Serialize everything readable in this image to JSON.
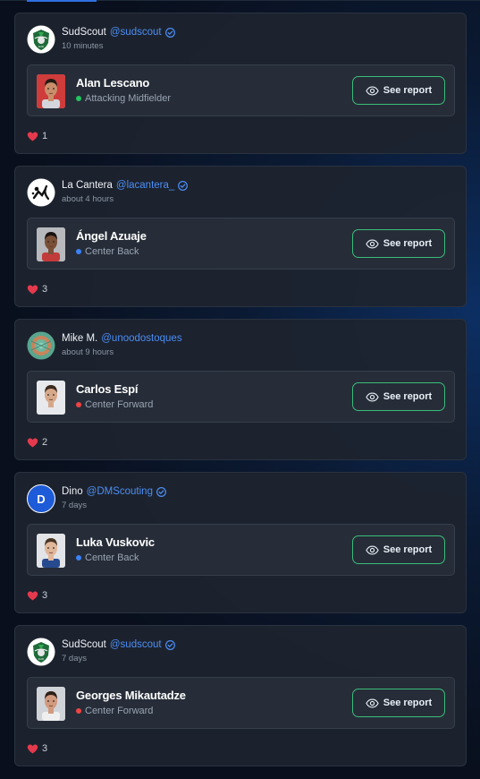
{
  "feed": {
    "posts": [
      {
        "author": {
          "name": "SudScout",
          "handle": "@sudscout",
          "verified": true,
          "avatar": "sudscout-logo"
        },
        "time": "10 minutes",
        "player": {
          "name": "Alan Lescano",
          "position": "Attacking Midfielder",
          "position_color": "#22c55e"
        },
        "button_label": "See report",
        "likes": "1"
      },
      {
        "author": {
          "name": "La Cantera",
          "handle": "@lacantera_",
          "verified": true,
          "avatar": "lacantera-logo"
        },
        "time": "about 4 hours",
        "player": {
          "name": "Ángel Azuaje",
          "position": "Center Back",
          "position_color": "#3b82f6"
        },
        "button_label": "See report",
        "likes": "3"
      },
      {
        "author": {
          "name": "Mike M.",
          "handle": "@unoodostoques",
          "verified": false,
          "avatar": "mike-avatar"
        },
        "time": "about 9 hours",
        "player": {
          "name": "Carlos Espí",
          "position": "Center Forward",
          "position_color": "#ef4444"
        },
        "button_label": "See report",
        "likes": "2"
      },
      {
        "author": {
          "name": "Dino",
          "handle": "@DMScouting",
          "verified": true,
          "avatar": "letter-avatar",
          "initial": "D"
        },
        "time": "7 days",
        "player": {
          "name": "Luka Vuskovic",
          "position": "Center Back",
          "position_color": "#3b82f6"
        },
        "button_label": "See report",
        "likes": "3"
      },
      {
        "author": {
          "name": "SudScout",
          "handle": "@sudscout",
          "verified": true,
          "avatar": "sudscout-logo"
        },
        "time": "7 days",
        "player": {
          "name": "Georges Mikautadze",
          "position": "Center Forward",
          "position_color": "#ef4444"
        },
        "button_label": "See report",
        "likes": "3"
      }
    ]
  },
  "colors": {
    "accent": "#3bbd7a",
    "link": "#4c8ef5",
    "heart": "#e5394d",
    "verified": "#4c8ef5"
  }
}
